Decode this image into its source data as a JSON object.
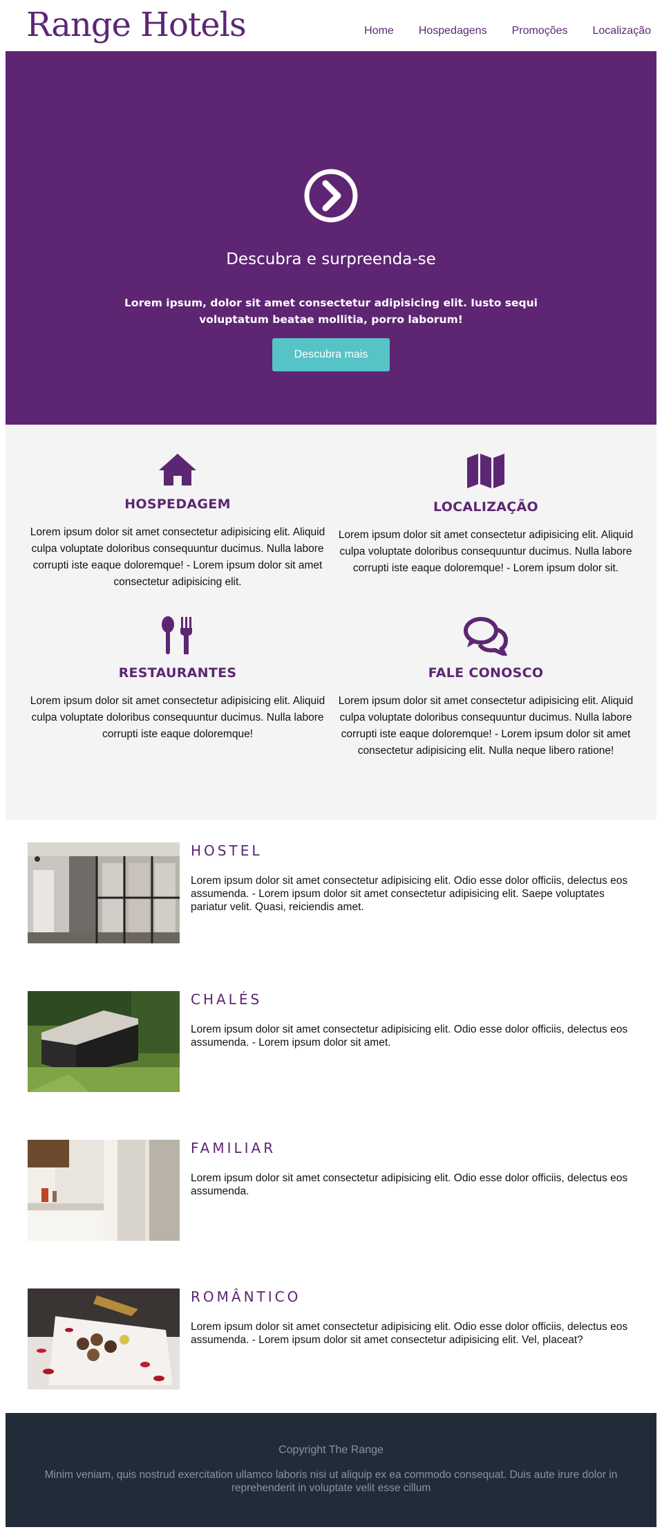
{
  "header": {
    "logo": "Range Hotels",
    "nav": [
      "Home",
      "Hospedagens",
      "Promoções",
      "Localização"
    ]
  },
  "hero": {
    "icon": "chevron-circle-right-icon",
    "title": "Descubra e surpreenda-se",
    "text": "Lorem ipsum, dolor sit amet consectetur adipisicing elit. Iusto sequi voluptatum beatae mollitia, porro laborum!",
    "button": "Descubra mais"
  },
  "services": [
    {
      "icon": "home-icon",
      "title": "HOSPEDAGEM",
      "text": "Lorem ipsum dolor sit amet consectetur adipisicing elit. Aliquid culpa voluptate doloribus consequuntur ducimus. Nulla labore corrupti iste eaque doloremque! - Lorem ipsum dolor sit amet consectetur adipisicing elit."
    },
    {
      "icon": "map-icon",
      "title": "LOCALIZAÇÃO",
      "text": "Lorem ipsum dolor sit amet consectetur adipisicing elit. Aliquid culpa voluptate doloribus consequuntur ducimus. Nulla labore corrupti iste eaque doloremque! - Lorem ipsum dolor sit."
    },
    {
      "icon": "utensils-icon",
      "title": "RESTAURANTES",
      "text": "Lorem ipsum dolor sit amet consectetur adipisicing elit. Aliquid culpa voluptate doloribus consequuntur ducimus. Nulla labore corrupti iste eaque doloremque!"
    },
    {
      "icon": "comments-icon",
      "title": "FALE CONOSCO",
      "text": "Lorem ipsum dolor sit amet consectetur adipisicing elit. Aliquid culpa voluptate doloribus consequuntur ducimus. Nulla labore corrupti iste eaque doloremque! - Lorem ipsum dolor sit amet consectetur adipisicing elit. Nulla neque libero ratione!"
    }
  ],
  "rooms": [
    {
      "title": "HOSTEL",
      "text": "Lorem ipsum dolor sit amet consectetur adipisicing elit. Odio esse dolor officiis, delectus eos assumenda. - Lorem ipsum dolor sit amet consectetur adipisicing elit. Saepe voluptates pariatur velit. Quasi, reiciendis amet."
    },
    {
      "title": "CHALÉS",
      "text": "Lorem ipsum dolor sit amet consectetur adipisicing elit. Odio esse dolor officiis, delectus eos assumenda. - Lorem ipsum dolor sit amet."
    },
    {
      "title": "FAMILIAR",
      "text": "Lorem ipsum dolor sit amet consectetur adipisicing elit. Odio esse dolor officiis, delectus eos assumenda."
    },
    {
      "title": "ROMÂNTICO",
      "text": "Lorem ipsum dolor sit amet consectetur adipisicing elit. Odio esse dolor officiis, delectus eos assumenda. - Lorem ipsum dolor sit amet consectetur adipisicing elit. Vel, placeat?"
    }
  ],
  "footer": {
    "copyright": "Copyright The Range",
    "text": "Minim veniam, quis nostrud exercitation ullamco laboris nisi ut aliquip ex ea commodo consequat. Duis aute irure dolor in reprehenderit in voluptate velit esse cillum"
  },
  "colors": {
    "brand": "#5e2573",
    "accent": "#56c3c7",
    "footer": "#222b38",
    "services_bg": "#f4f4f4"
  }
}
